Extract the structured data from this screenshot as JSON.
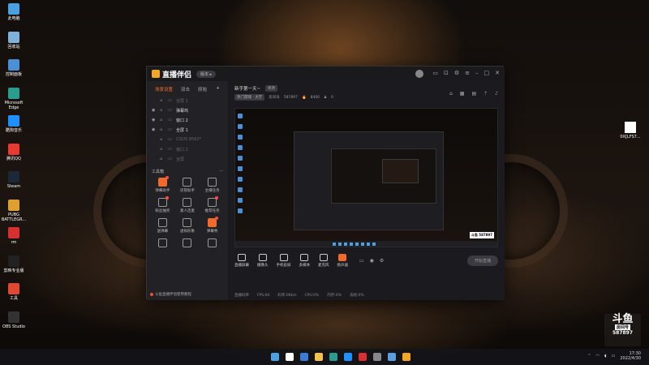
{
  "desktop_icons": [
    {
      "label": "此电脑",
      "color": "#4aa0e0",
      "glyph": "monitor-icon"
    },
    {
      "label": "回收站",
      "color": "#7fb2d8",
      "glyph": "recycle-bin-icon"
    },
    {
      "label": "控制面板",
      "color": "#4a8fd8",
      "glyph": "control-panel-icon"
    },
    {
      "label": "Microsoft Edge",
      "color": "#2a9d8f",
      "glyph": "edge-icon"
    },
    {
      "label": "酷狗音乐",
      "color": "#1e90ff",
      "glyph": "kugou-icon"
    },
    {
      "label": "腾讯QQ",
      "color": "#e83a30",
      "glyph": "qq-icon"
    },
    {
      "label": "Steam",
      "color": "#1b2838",
      "glyph": "steam-icon"
    },
    {
      "label": "PUBG BATTLEGR...",
      "color": "#e0a030",
      "glyph": "pubg-icon"
    },
    {
      "label": "rm",
      "color": "#d83030",
      "glyph": "app-icon"
    },
    {
      "label": "剪映专业版",
      "color": "#222222",
      "glyph": "jianying-icon"
    },
    {
      "label": "工具",
      "color": "#e04830",
      "glyph": "tool-icon"
    },
    {
      "label": "OBS Studio",
      "color": "#333333",
      "glyph": "obs-icon"
    }
  ],
  "right_desktop_icon": {
    "label": "0X[LFS7..."
  },
  "app": {
    "name": "直播伴侣",
    "version_badge": "版本 ▸",
    "left_panel": {
      "tabs": [
        "场景设置",
        "双击",
        "原始"
      ],
      "plus": "+",
      "scenes": [
        {
          "name": "全屏 1",
          "active": false
        },
        {
          "name": "弹幕鸡",
          "active": true
        },
        {
          "name": "窗口 2",
          "active": true
        },
        {
          "name": "全屏 1",
          "active": true
        },
        {
          "name": "COUS 8562*",
          "active": false
        },
        {
          "name": "窗口 2",
          "active": false
        },
        {
          "name": "全屏",
          "active": false
        }
      ],
      "toolbox_title": "工具箱",
      "toolbox_more": "···",
      "tools": [
        {
          "label": "弹幕助手",
          "highlight": true,
          "badge": true
        },
        {
          "label": "房管助手",
          "highlight": false,
          "badge": false
        },
        {
          "label": "主播任务",
          "highlight": false,
          "badge": false
        },
        {
          "label": "粉丝抽奖",
          "highlight": false,
          "badge": true
        },
        {
          "label": "素人连麦",
          "highlight": false,
          "badge": false
        },
        {
          "label": "推荐任务",
          "highlight": false,
          "badge": true
        },
        {
          "label": "送弹幕",
          "highlight": false,
          "badge": false
        },
        {
          "label": "虚拟形象",
          "highlight": false,
          "badge": false
        },
        {
          "label": "弹幕秀",
          "highlight": true,
          "badge": true
        },
        {
          "label": "",
          "highlight": false,
          "badge": false
        },
        {
          "label": "",
          "highlight": false,
          "badge": false
        },
        {
          "label": "",
          "highlight": false,
          "badge": false
        }
      ],
      "bottom_link": "斗鱼直播伴侣使用教程"
    },
    "main": {
      "room_title": "新手第一天~",
      "edit_label": "修改",
      "category": "热门游戏 · 大厅",
      "room_id_label": "房间号",
      "room_id": "587897",
      "heat": "8400",
      "followers": "0",
      "controls": [
        "直播屏幕",
        "摄像头",
        "手机投屏",
        "多媒体",
        "麦克风",
        "扬声器"
      ],
      "start_button": "开始直播",
      "status": [
        "直播码率",
        "FPS:60",
        "码率:0Kb/s",
        "CPU:0%",
        "内存:0%",
        "丢帧:0%"
      ]
    }
  },
  "douyu_badge": {
    "brand": "斗鱼",
    "sub": "房间号",
    "room": "587897"
  },
  "taskbar": {
    "time": "17:30",
    "date": "2022/4/30",
    "icon_colors": [
      "#4aa0e0",
      "#ffffff",
      "#3a7bd5",
      "#f2c14e",
      "#2a9d8f",
      "#1e90ff",
      "#d83030",
      "#888888",
      "#5aa0e0",
      "#f5a623"
    ]
  },
  "preview_watermark": "斗鱼 587897"
}
